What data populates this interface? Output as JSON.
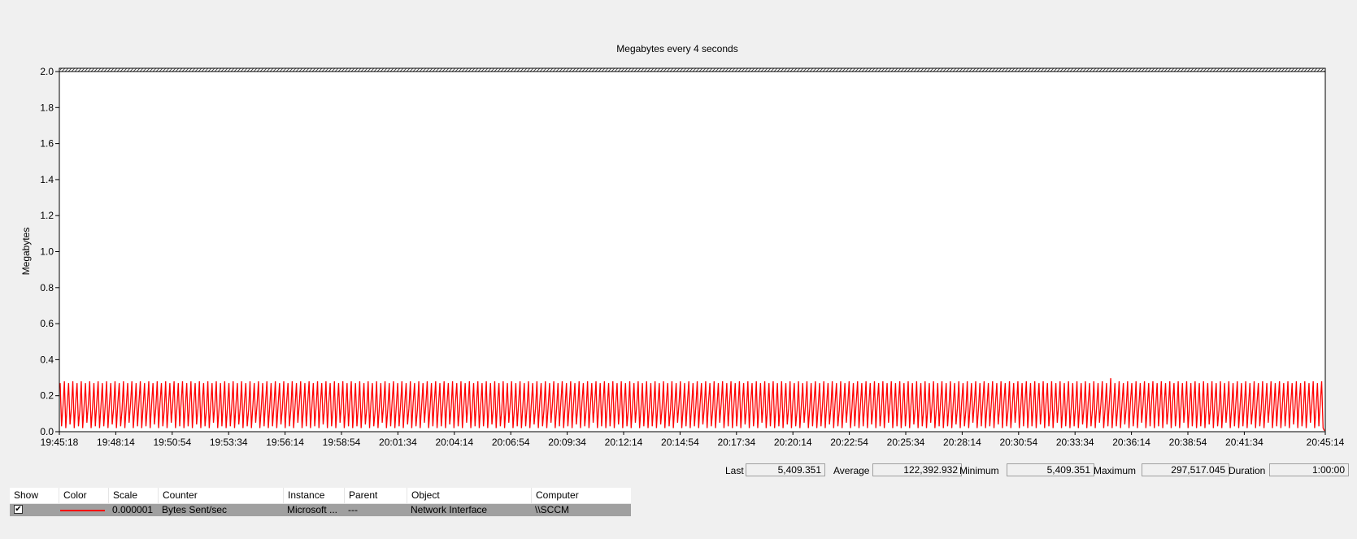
{
  "chart_data": {
    "type": "line",
    "title": "Megabytes every 4 seconds",
    "ylabel": "Megabytes",
    "xlabel": "",
    "ylim": [
      0,
      2.0
    ],
    "yticks": [
      "0.0",
      "0.2",
      "0.4",
      "0.6",
      "0.8",
      "1.0",
      "1.2",
      "1.4",
      "1.6",
      "1.8",
      "2.0"
    ],
    "xticks": [
      "19:45:18",
      "19:48:14",
      "19:50:54",
      "19:53:34",
      "19:56:14",
      "19:58:54",
      "20:01:34",
      "20:04:14",
      "20:06:54",
      "20:09:34",
      "20:12:14",
      "20:14:54",
      "20:17:34",
      "20:20:14",
      "20:22:54",
      "20:25:34",
      "20:28:14",
      "20:30:54",
      "20:33:34",
      "20:36:14",
      "20:38:54",
      "20:41:34",
      "20:45:14"
    ],
    "grid": false,
    "series": [
      {
        "color": "#ff0000",
        "sample_interval_seconds": 4,
        "pattern_megabytes": [
          0.27,
          0.03,
          0.14,
          0.28,
          0.02,
          0.15,
          0.27,
          0.04,
          0.13,
          0.28,
          0.02,
          0.16,
          0.27,
          0.03,
          0.12,
          0.28,
          0.02,
          0.14,
          0.27,
          0.05,
          0.15,
          0.28,
          0.02,
          0.13,
          0.27,
          0.03,
          0.16,
          0.28,
          0.02,
          0.14
        ],
        "peak_megabytes": 0.297517045,
        "last_megabytes": 0.005409351
      }
    ]
  },
  "stats": {
    "last_label": "Last",
    "last_value": "5,409.351",
    "average_label": "Average",
    "average_value": "122,392.932",
    "minimum_label": "Minimum",
    "minimum_value": "5,409.351",
    "maximum_label": "Maximum",
    "maximum_value": "297,517.045",
    "duration_label": "Duration",
    "duration_value": "1:00:00"
  },
  "table": {
    "headers": [
      "Show",
      "Color",
      "Scale",
      "Counter",
      "Instance",
      "Parent",
      "Object",
      "Computer"
    ],
    "row": {
      "show": "✔",
      "color": "#ff0000",
      "scale": "0.000001",
      "counter": "Bytes Sent/sec",
      "instance": "Microsoft ...",
      "parent": "---",
      "object": "Network Interface",
      "computer": "\\\\SCCM"
    }
  }
}
